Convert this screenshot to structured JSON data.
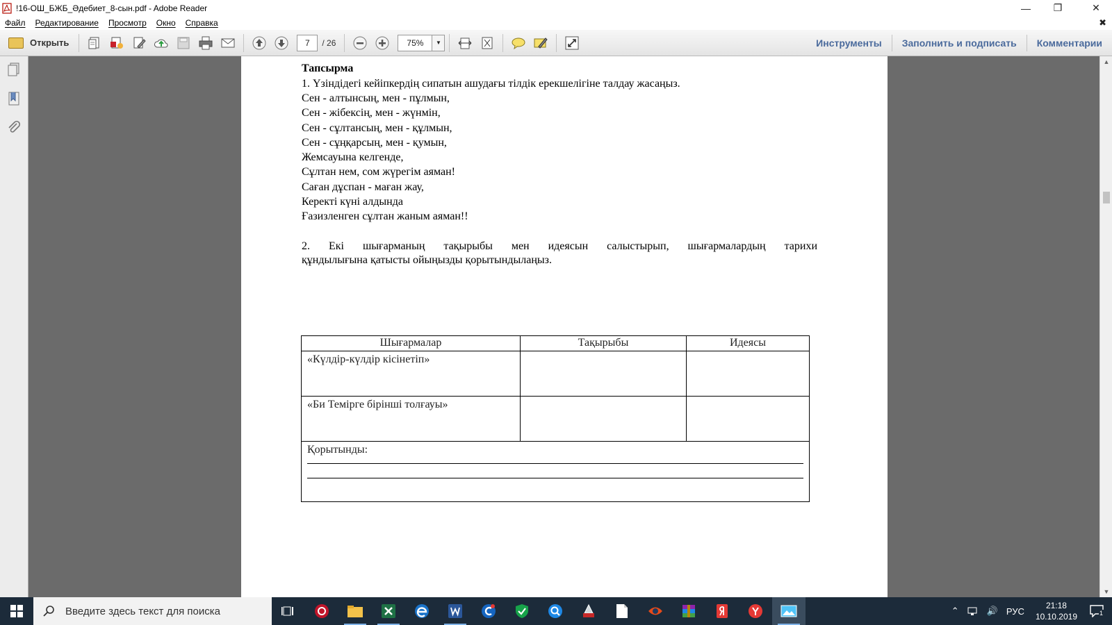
{
  "window": {
    "title": "!16-ОШ_БЖБ_Әдебиет_8-сын.pdf - Adobe Reader"
  },
  "menu": [
    "Файл",
    "Редактирование",
    "Просмотр",
    "Окно",
    "Справка"
  ],
  "toolbar": {
    "open_label": "Открыть",
    "current_page": "7",
    "total_pages": "/ 26",
    "zoom": "75%",
    "tools_label": "Инструменты",
    "fill_sign_label": "Заполнить и подписать",
    "comments_label": "Комментарии"
  },
  "document": {
    "heading": "Тапсырма",
    "task1": "1. Үзіндідегі кейіпкердің сипатын ашудағы тілдік ерекшелігіне талдау жасаңыз.",
    "poem": [
      "Сен - алтынсың, мен - пұлмын,",
      "Сен - жібексің, мен - жүнмін,",
      "Сен - сұлтансың, мен - құлмын,",
      "Сен - сұңқарсың, мен - қумын,",
      "Жемсауына келгенде,",
      "Сұлтан нем, сом жүрегім аяман!",
      "Саған дұспан - маған жау,",
      "Керекті күні алдында",
      "Ғазизленген сұлтан жаным аяман!!"
    ],
    "task2_line1": "2. Екі шығарманың тақырыбы мен идеясын салыстырып, шығармалардың тарихи",
    "task2_line2": "құндылығына қатысты ойыңызды қорытындылаңыз.",
    "table": {
      "headers": [
        "Шығармалар",
        "Тақырыбы",
        "Идеясы"
      ],
      "rows": [
        "«Күлдір-күлдір кісінетіп»",
        "«Би Темірге бірінші толғауы»"
      ],
      "conclusion_label": "Қорытынды:"
    },
    "page_number": "7"
  },
  "taskbar": {
    "search_placeholder": "Введите здесь текст для поиска",
    "lang": "РУС",
    "time": "21:18",
    "date": "10.10.2019",
    "notifications": "1"
  }
}
